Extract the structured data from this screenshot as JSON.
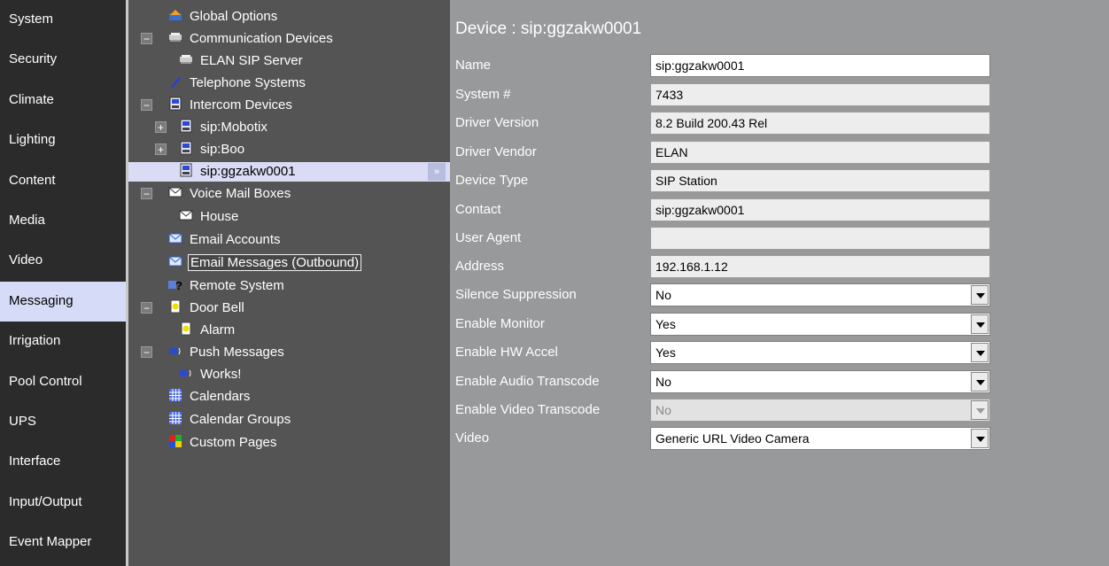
{
  "nav": [
    {
      "label": "System",
      "active": false
    },
    {
      "label": "Security",
      "active": false
    },
    {
      "label": "Climate",
      "active": false
    },
    {
      "label": "Lighting",
      "active": false
    },
    {
      "label": "Content",
      "active": false
    },
    {
      "label": "Media",
      "active": false
    },
    {
      "label": "Video",
      "active": false
    },
    {
      "label": "Messaging",
      "active": true
    },
    {
      "label": "Irrigation",
      "active": false
    },
    {
      "label": "Pool Control",
      "active": false
    },
    {
      "label": "UPS",
      "active": false
    },
    {
      "label": "Interface",
      "active": false
    },
    {
      "label": "Input/Output",
      "active": false
    },
    {
      "label": "Event Mapper",
      "active": false
    }
  ],
  "tree": [
    {
      "label": "Global Options",
      "icon": "global-options-icon",
      "expander": ""
    },
    {
      "label": "Communication Devices",
      "icon": "server-icon",
      "expander": "−"
    },
    {
      "label": "ELAN SIP Server",
      "icon": "server-icon",
      "expander": ""
    },
    {
      "label": "Telephone Systems",
      "icon": "telephone-icon",
      "expander": ""
    },
    {
      "label": "Intercom Devices",
      "icon": "intercom-icon",
      "expander": "−"
    },
    {
      "label": "sip:Mobotix",
      "icon": "intercom-icon",
      "expander": "+"
    },
    {
      "label": "sip:Boo",
      "icon": "intercom-icon",
      "expander": "+"
    },
    {
      "label": "sip:ggzakw0001",
      "icon": "intercom-icon",
      "expander": "+",
      "selected": true
    },
    {
      "label": "Voice Mail Boxes",
      "icon": "envelope-icon",
      "expander": "−"
    },
    {
      "label": "House",
      "icon": "envelope-icon",
      "expander": ""
    },
    {
      "label": "Email Accounts",
      "icon": "email-icon",
      "expander": ""
    },
    {
      "label": "Email Messages (Outbound)",
      "icon": "email-icon",
      "expander": "",
      "boxed": true
    },
    {
      "label": "Remote System",
      "icon": "remote-system-icon",
      "expander": ""
    },
    {
      "label": "Door Bell",
      "icon": "door-bell-icon",
      "expander": "−"
    },
    {
      "label": "Alarm",
      "icon": "door-bell-icon",
      "expander": ""
    },
    {
      "label": "Push Messages",
      "icon": "push-message-icon",
      "expander": "−"
    },
    {
      "label": "Works!",
      "icon": "push-message-icon",
      "expander": ""
    },
    {
      "label": "Calendars",
      "icon": "calendar-icon",
      "expander": ""
    },
    {
      "label": "Calendar Groups",
      "icon": "calendar-icon",
      "expander": ""
    },
    {
      "label": "Custom Pages",
      "icon": "custom-pages-icon",
      "expander": ""
    }
  ],
  "detail": {
    "title": "Device : sip:ggzakw0001",
    "fields": [
      {
        "label": "Name",
        "value": "sip:ggzakw0001",
        "kind": "edit"
      },
      {
        "label": "System #",
        "value": "7433",
        "kind": "ro"
      },
      {
        "label": "Driver Version",
        "value": "8.2 Build 200.43 Rel",
        "kind": "ro"
      },
      {
        "label": "Driver Vendor",
        "value": "ELAN",
        "kind": "ro"
      },
      {
        "label": "Device Type",
        "value": "SIP Station",
        "kind": "ro"
      },
      {
        "label": "Contact",
        "value": "sip:ggzakw0001",
        "kind": "ro"
      },
      {
        "label": "User Agent",
        "value": "",
        "kind": "ro"
      },
      {
        "label": "Address",
        "value": "192.168.1.12",
        "kind": "ro"
      },
      {
        "label": "Silence Suppression",
        "value": "No",
        "kind": "select"
      },
      {
        "label": "Enable Monitor",
        "value": "Yes",
        "kind": "select"
      },
      {
        "label": "Enable HW Accel",
        "value": "Yes",
        "kind": "select"
      },
      {
        "label": "Enable Audio Transcode",
        "value": "No",
        "kind": "select"
      },
      {
        "label": "Enable Video Transcode",
        "value": "No",
        "kind": "select-disabled"
      },
      {
        "label": "Video",
        "value": "Generic URL Video Camera",
        "kind": "select"
      }
    ]
  },
  "colors": {
    "nav_bg": "#2b2b2b",
    "nav_active": "#d6dcf7",
    "tree_bg": "#545454",
    "detail_bg": "#98999a",
    "tree_selected": "#d9dcf4"
  }
}
